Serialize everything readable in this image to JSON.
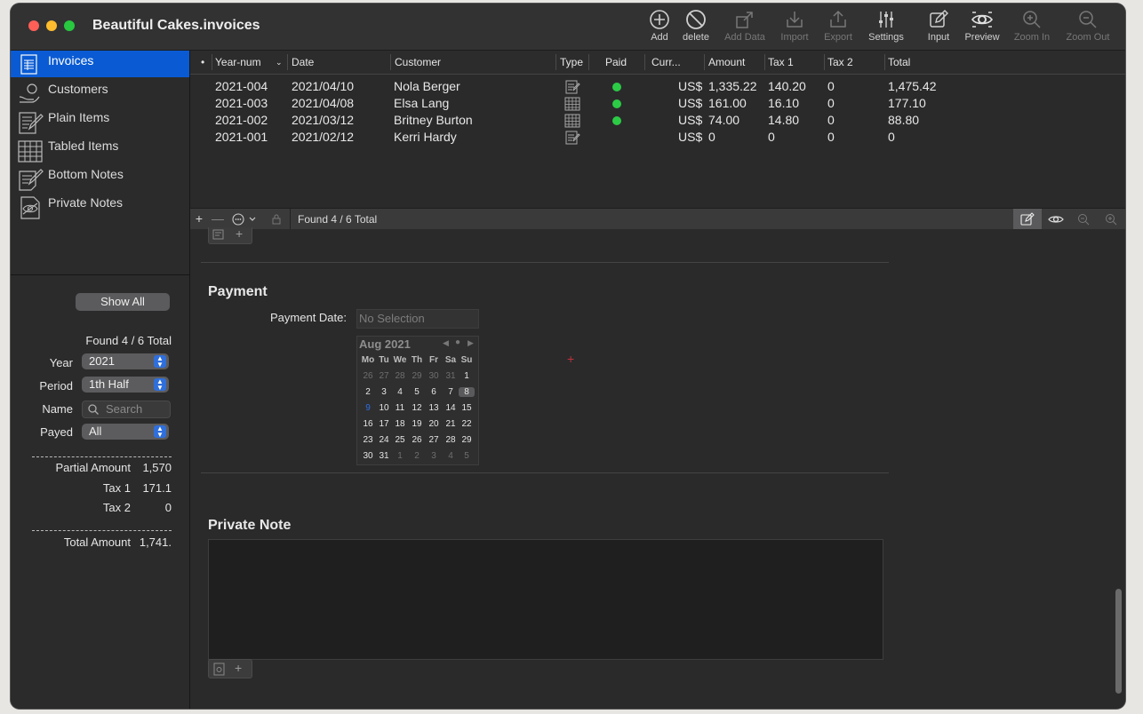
{
  "window": {
    "title": "Beautiful Cakes.invoices"
  },
  "toolbar": [
    {
      "label": "Add",
      "icon": "add-icon",
      "enabled": true
    },
    {
      "label": "delete",
      "icon": "delete-icon",
      "enabled": true
    },
    {
      "label": "Add Data",
      "icon": "add-data-icon",
      "enabled": false
    },
    {
      "label": "Import",
      "icon": "import-icon",
      "enabled": false
    },
    {
      "label": "Export",
      "icon": "export-icon",
      "enabled": false
    },
    {
      "label": "Settings",
      "icon": "settings-icon",
      "enabled": true
    },
    {
      "label": "Input",
      "icon": "input-icon",
      "enabled": true
    },
    {
      "label": "Preview",
      "icon": "preview-icon",
      "enabled": true
    },
    {
      "label": "Zoom In",
      "icon": "zoom-in-icon",
      "enabled": false
    },
    {
      "label": "Zoom Out",
      "icon": "zoom-out-icon",
      "enabled": false
    }
  ],
  "sidebar": {
    "items": [
      {
        "label": "Invoices",
        "icon": "invoices-icon",
        "selected": true
      },
      {
        "label": "Customers",
        "icon": "customers-icon",
        "selected": false
      },
      {
        "label": "Plain Items",
        "icon": "plain-items-icon",
        "selected": false
      },
      {
        "label": "Tabled Items",
        "icon": "tabled-items-icon",
        "selected": false
      },
      {
        "label": "Bottom Notes",
        "icon": "bottom-notes-icon",
        "selected": false
      },
      {
        "label": "Private Notes",
        "icon": "private-notes-icon",
        "selected": false
      }
    ]
  },
  "filters": {
    "show_all": "Show All",
    "found": "Found 4 / 6 Total",
    "year_label": "Year",
    "year_value": "2021",
    "period_label": "Period",
    "period_value": "1th Half",
    "name_label": "Name",
    "name_placeholder": "Search",
    "payed_label": "Payed",
    "payed_value": "All",
    "dashes": "-------------------------",
    "partial_label": "Partial Amount",
    "partial_value": "1,570",
    "tax1_label": "Tax 1",
    "tax1_value": "171.1",
    "tax2_label": "Tax 2",
    "tax2_value": "0",
    "total_label": "Total Amount",
    "total_value": "1,741."
  },
  "table": {
    "columns": [
      "•",
      "Year-num",
      "Date",
      "Customer",
      "Type",
      "Paid",
      "Curr...",
      "Amount",
      "Tax 1",
      "Tax 2",
      "Total"
    ],
    "rows": [
      {
        "yearnum": "2021-004",
        "date": "2021/04/10",
        "customer": "Nola Berger",
        "type": "plain",
        "paid": true,
        "curr": "US$",
        "amount": "1,335.22",
        "tax1": "140.20",
        "tax2": "0",
        "total": "1,475.42"
      },
      {
        "yearnum": "2021-003",
        "date": "2021/04/08",
        "customer": "Elsa Lang",
        "type": "tabled",
        "paid": true,
        "curr": "US$",
        "amount": "161.00",
        "tax1": "16.10",
        "tax2": "0",
        "total": "177.10"
      },
      {
        "yearnum": "2021-002",
        "date": "2021/03/12",
        "customer": "Britney Burton",
        "type": "tabled",
        "paid": true,
        "curr": "US$",
        "amount": "74.00",
        "tax1": "14.80",
        "tax2": "0",
        "total": "88.80"
      },
      {
        "yearnum": "2021-001",
        "date": "2021/02/12",
        "customer": "Kerri Hardy",
        "type": "plain",
        "paid": false,
        "curr": "US$",
        "amount": "0",
        "tax1": "0",
        "tax2": "0",
        "total": "0"
      }
    ]
  },
  "bottombar": {
    "add": "+",
    "remove": "—",
    "status": "Found 4 / 6 Total"
  },
  "payment": {
    "heading": "Payment",
    "date_label": "Payment Date:",
    "date_placeholder": "No Selection",
    "calendar": {
      "month": "Aug 2021",
      "weekdays": [
        "Mo",
        "Tu",
        "We",
        "Th",
        "Fr",
        "Sa",
        "Su"
      ],
      "weeks": [
        [
          "26",
          "27",
          "28",
          "29",
          "30",
          "31",
          "1"
        ],
        [
          "2",
          "3",
          "4",
          "5",
          "6",
          "7",
          "8"
        ],
        [
          "9",
          "10",
          "11",
          "12",
          "13",
          "14",
          "15"
        ],
        [
          "16",
          "17",
          "18",
          "19",
          "20",
          "21",
          "22"
        ],
        [
          "23",
          "24",
          "25",
          "26",
          "27",
          "28",
          "29"
        ],
        [
          "30",
          "31",
          "1",
          "2",
          "3",
          "4",
          "5"
        ]
      ],
      "selected": "8",
      "today": "9"
    }
  },
  "private_note": {
    "heading": "Private Note",
    "text": ""
  },
  "colors": {
    "accent": "#0a5bd3",
    "paid": "#2ccb46",
    "today": "#2f6fdc"
  }
}
